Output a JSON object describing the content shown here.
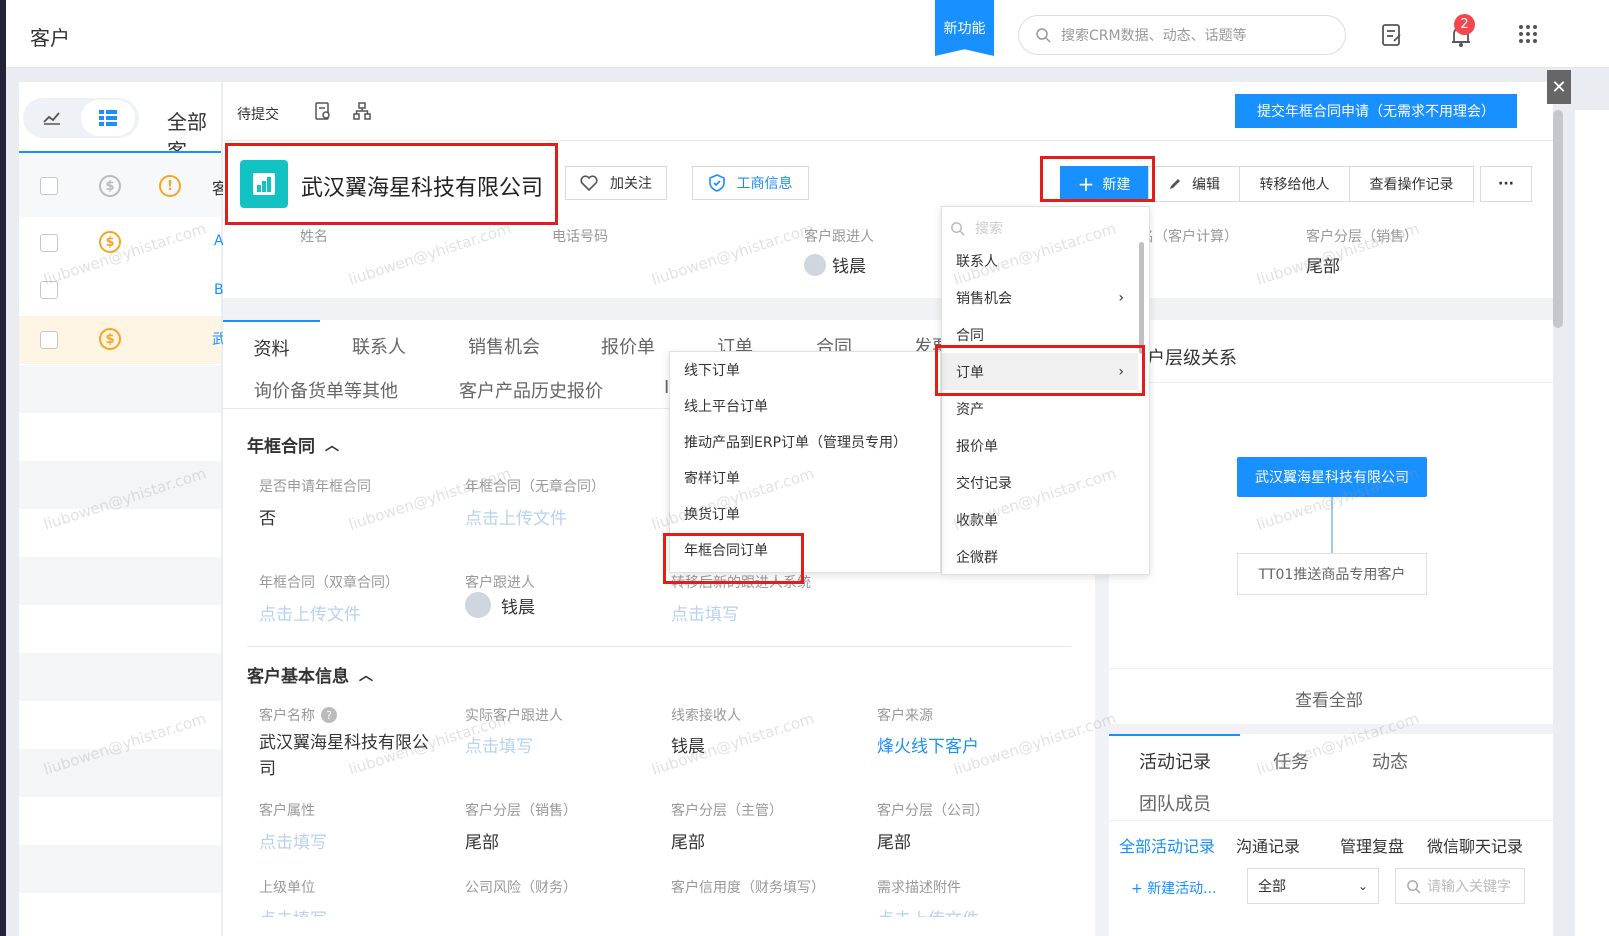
{
  "topbar": {
    "title": "客户",
    "new_feature": "新功能",
    "search_placeholder": "搜索CRM数据、动态、话题等",
    "notif_count": "2"
  },
  "listpanel": {
    "partial_title": "全部客",
    "row_letters": [
      "A",
      "B",
      "武"
    ],
    "header_partial": "客"
  },
  "detail": {
    "status": "待提交",
    "submit_button": "提交年框合同申请（无需求不用理会）",
    "company": "武汉翼海星科技有限公司",
    "follow": "加关注",
    "bizinfo": "工商信息",
    "actions": {
      "new": "新建",
      "edit": "编辑",
      "transfer": "转移给他人",
      "log": "查看操作记录",
      "more": "···"
    },
    "header_fields": {
      "name_label": "姓名",
      "phone_label": "电话号码",
      "owner_label": "客户跟进人",
      "owner": "钱晨",
      "calc_label": "名（客户计算）",
      "seg_label": "客户分层（销售）",
      "seg": "尾部"
    },
    "tabs": [
      "资料",
      "联系人",
      "销售机会",
      "报价单",
      "订单",
      "合同",
      "发票"
    ],
    "tabs2": [
      "询价备货单等其他",
      "客户产品历史报价",
      "I"
    ],
    "section1": {
      "title": "年框合同",
      "apply_label": "是否申请年框合同",
      "apply": "否",
      "nostamp_label": "年框合同（无章合同）",
      "upload": "点击上传文件",
      "double_label": "年框合同（双章合同）",
      "owner_label": "客户跟进人",
      "owner": "钱晨",
      "transfer_label": "转移后新的跟进人系统",
      "fill": "点击填写"
    },
    "section2": {
      "title": "客户基本信息",
      "name_label": "客户名称",
      "name": "武汉翼海星科技有限公司",
      "actual_label": "实际客户跟进人",
      "actual": "点击填写",
      "leads_label": "线索接收人",
      "leads": "钱晨",
      "source_label": "客户来源",
      "source": "烽火线下客户",
      "attr_label": "客户属性",
      "attr": "点击填写",
      "seg_sales_label": "客户分层（销售）",
      "seg_sales": "尾部",
      "seg_mgr_label": "客户分层（主管）",
      "seg_mgr": "尾部",
      "seg_co_label": "客户分层（公司）",
      "seg_co": "尾部",
      "parent_label": "上级单位",
      "parent": "点击填写",
      "risk_label": "公司风险（财务）",
      "credit_label": "客户信用度（财务填写）",
      "needs_label": "需求描述附件",
      "needs": "点击上传文件"
    }
  },
  "new_menu": {
    "search_placeholder": "搜索",
    "items": [
      "联系人",
      "销售机会",
      "合同",
      "订单",
      "资产",
      "报价单",
      "交付记录",
      "收款单",
      "企微群"
    ]
  },
  "order_submenu": {
    "items": [
      "线下订单",
      "线上平台订单",
      "推动产品到ERP订单（管理员专用）",
      "寄样订单",
      "换货订单",
      "年框合同订单"
    ]
  },
  "right": {
    "hier_title": "户层级关系",
    "node_main": "武汉翼海星科技有限公司",
    "node_child": "TT01推送商品专用客户",
    "view_all": "查看全部",
    "tabs": [
      "活动记录",
      "任务",
      "动态",
      "团队成员"
    ],
    "subtabs": [
      "全部活动记录",
      "沟通记录",
      "管理复盘",
      "微信聊天记录"
    ],
    "new_activity": "+ 新建活动...",
    "filter": "全部",
    "kw_placeholder": "请输入关键字"
  },
  "watermark": "liubowen@yhistar.com",
  "colors": {
    "accent": "#1890ff",
    "red": "#e41c1c"
  }
}
